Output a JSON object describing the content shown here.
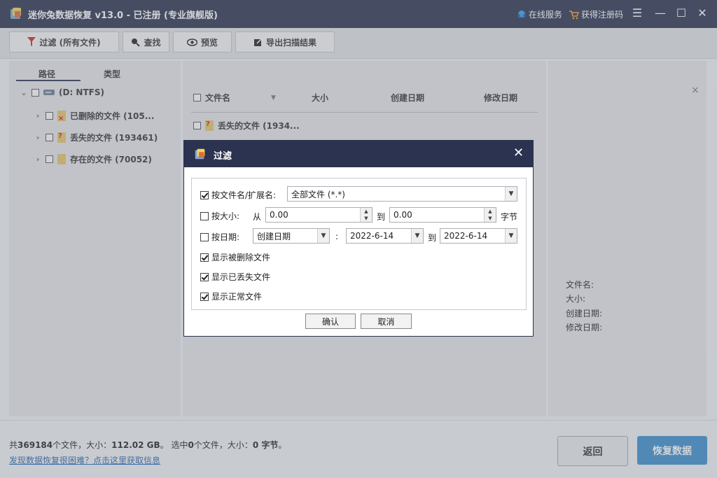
{
  "app": {
    "title": "迷你兔数据恢复 v13.0 - 已注册 (专业旗舰版)",
    "online_service": "在线服务",
    "get_code": "获得注册码"
  },
  "toolbar": {
    "filter": "过滤 (所有文件)",
    "find": "查找",
    "preview": "预览",
    "export": "导出扫描结果"
  },
  "left": {
    "tabs": [
      "路径",
      "类型"
    ],
    "drive": "(D: NTFS)",
    "items": [
      {
        "label": "已删除的文件 (105..."
      },
      {
        "label": "丢失的文件 (193461)"
      },
      {
        "label": "存在的文件 (70052)"
      }
    ]
  },
  "table": {
    "headers": [
      "文件名",
      "大小",
      "创建日期",
      "修改日期"
    ],
    "rows": [
      {
        "name": "丢失的文件 (1934..."
      }
    ]
  },
  "right": {
    "close": "×",
    "labels": [
      "文件名:",
      "大小:",
      "创建日期:",
      "修改日期:"
    ]
  },
  "bottom": {
    "summary_prefix": "共",
    "total_files": "369184",
    "summary_files_unit": "个文件，大小：",
    "total_size": "112.02 GB",
    "summary_sel_prefix": "。 选中",
    "selected_files": "0",
    "summary_sel_unit": "个文件，大小：",
    "selected_size": "0 字节",
    "summary_end": "。",
    "help_link": "发现数据恢复很困难？点击这里获取信息",
    "back": "返回",
    "recover": "恢复数据"
  },
  "dialog": {
    "title": "过滤",
    "by_name_label": "按文件名/扩展名:",
    "by_name_value": "全部文件 (*.*)",
    "by_size_label": "按大小:",
    "from": "从",
    "size_from": "0.00",
    "to": "到",
    "size_to": "0.00",
    "size_unit": "字节",
    "by_date_label": "按日期:",
    "date_type": "创建日期",
    "colon": ":",
    "date_from": "2022-6-14",
    "date_to": "2022-6-14",
    "show_deleted": "显示被删除文件",
    "show_lost": "显示已丢失文件",
    "show_normal": "显示正常文件",
    "ok": "确认",
    "cancel": "取消"
  },
  "colors": {
    "titlebar": "#2b3350",
    "accent_button": "#3d8fd0",
    "link": "#2766b4"
  }
}
